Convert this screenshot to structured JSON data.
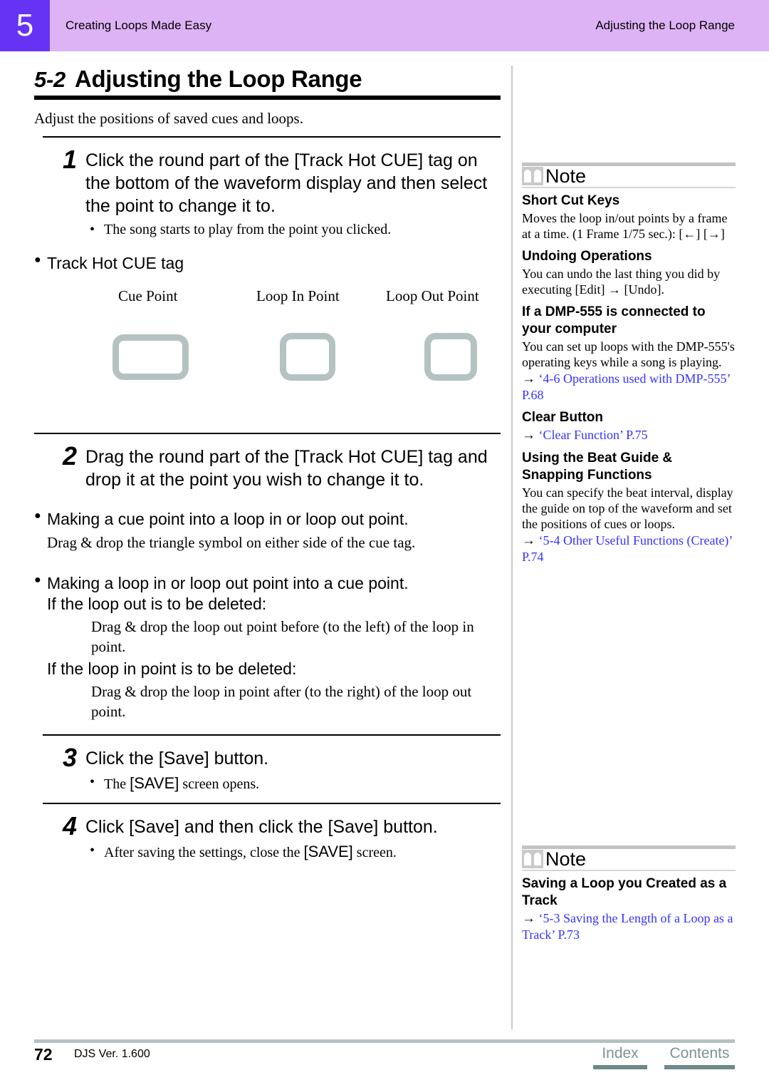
{
  "header": {
    "chapter_number": "5",
    "left_title": "Creating Loops Made Easy",
    "right_title": "Adjusting the Loop Range",
    "badge_color": "#6633f5",
    "band_color": "#ddb3f5"
  },
  "section": {
    "number": "5-2",
    "title": "Adjusting the Loop Range",
    "intro": "Adjust the positions of saved cues and loops."
  },
  "steps": [
    {
      "number": "1",
      "title": "Click the round part of the [Track Hot CUE] tag on the bottom of the waveform display and then select the point to change it to.",
      "bullet": "The song starts to play from the point you clicked."
    },
    {
      "number": "2",
      "title": "Drag the round part of the [Track Hot CUE] tag and drop it at the point you wish to change it to."
    },
    {
      "number": "3",
      "title": "Click the [Save] button.",
      "bullet_pre": "The ",
      "bullet_key": "[SAVE]",
      "bullet_post": " screen opens."
    },
    {
      "number": "4",
      "title": "Click [Save] and then click the [Save] button.",
      "bullet_pre": "After saving the settings, close the ",
      "bullet_key": "[SAVE]",
      "bullet_post": " screen."
    }
  ],
  "figure": {
    "heading": "Track Hot CUE tag",
    "labels": [
      "Cue Point",
      "Loop In Point",
      "Loop Out Point"
    ],
    "placeholder_border_color": "#b4c2c2"
  },
  "sub_sections": [
    {
      "heading": "Making a cue point into a loop in or loop out point.",
      "body": "Drag & drop the triangle symbol on either side of the cue tag."
    },
    {
      "heading": "Making a loop in or loop out point into a cue point.",
      "case1_label": "If the loop out is to be deleted:",
      "case1_body": "Drag & drop the loop out point before (to the left) of the loop in point.",
      "case2_label": "If the loop in point is to be deleted:",
      "case2_body": "Drag & drop the loop in point after (to the right) of the loop out point."
    }
  ],
  "notes": [
    {
      "title": "Note",
      "icon": "book-icon",
      "entries": [
        {
          "heading": "Short Cut Keys",
          "body": "Moves the loop in/out points by a frame at a time. (1 Frame   1/75 sec.): [←] [→]"
        },
        {
          "heading": "Undoing Operations",
          "body": "You can undo the last thing you did by executing [Edit] → [Undo]."
        },
        {
          "heading": "If a DMP-555 is connected to your computer",
          "body": "You can set up loops with the DMP-555's operating keys while a song is playing.",
          "link": "‘4-6 Operations used with DMP-555’ P.68"
        },
        {
          "heading": "Clear Button",
          "link": "‘Clear Function’ P.75"
        },
        {
          "heading": "Using the Beat Guide & Snapping Functions",
          "body": "You can specify the beat interval, display the guide on top of the waveform and set the positions of cues or loops.",
          "link": "‘5-4 Other Useful Functions (Create)’ P.74"
        }
      ]
    },
    {
      "title": "Note",
      "icon": "book-icon",
      "entries": [
        {
          "heading": "Saving a Loop you Created as a Track",
          "link": "‘5-3 Saving the Length of a Loop as a Track’ P.73"
        }
      ]
    }
  ],
  "footer": {
    "page_number": "72",
    "version": "DJS Ver. 1.600",
    "index_label": "Index",
    "contents_label": "Contents",
    "link_color": "#7d9292"
  }
}
